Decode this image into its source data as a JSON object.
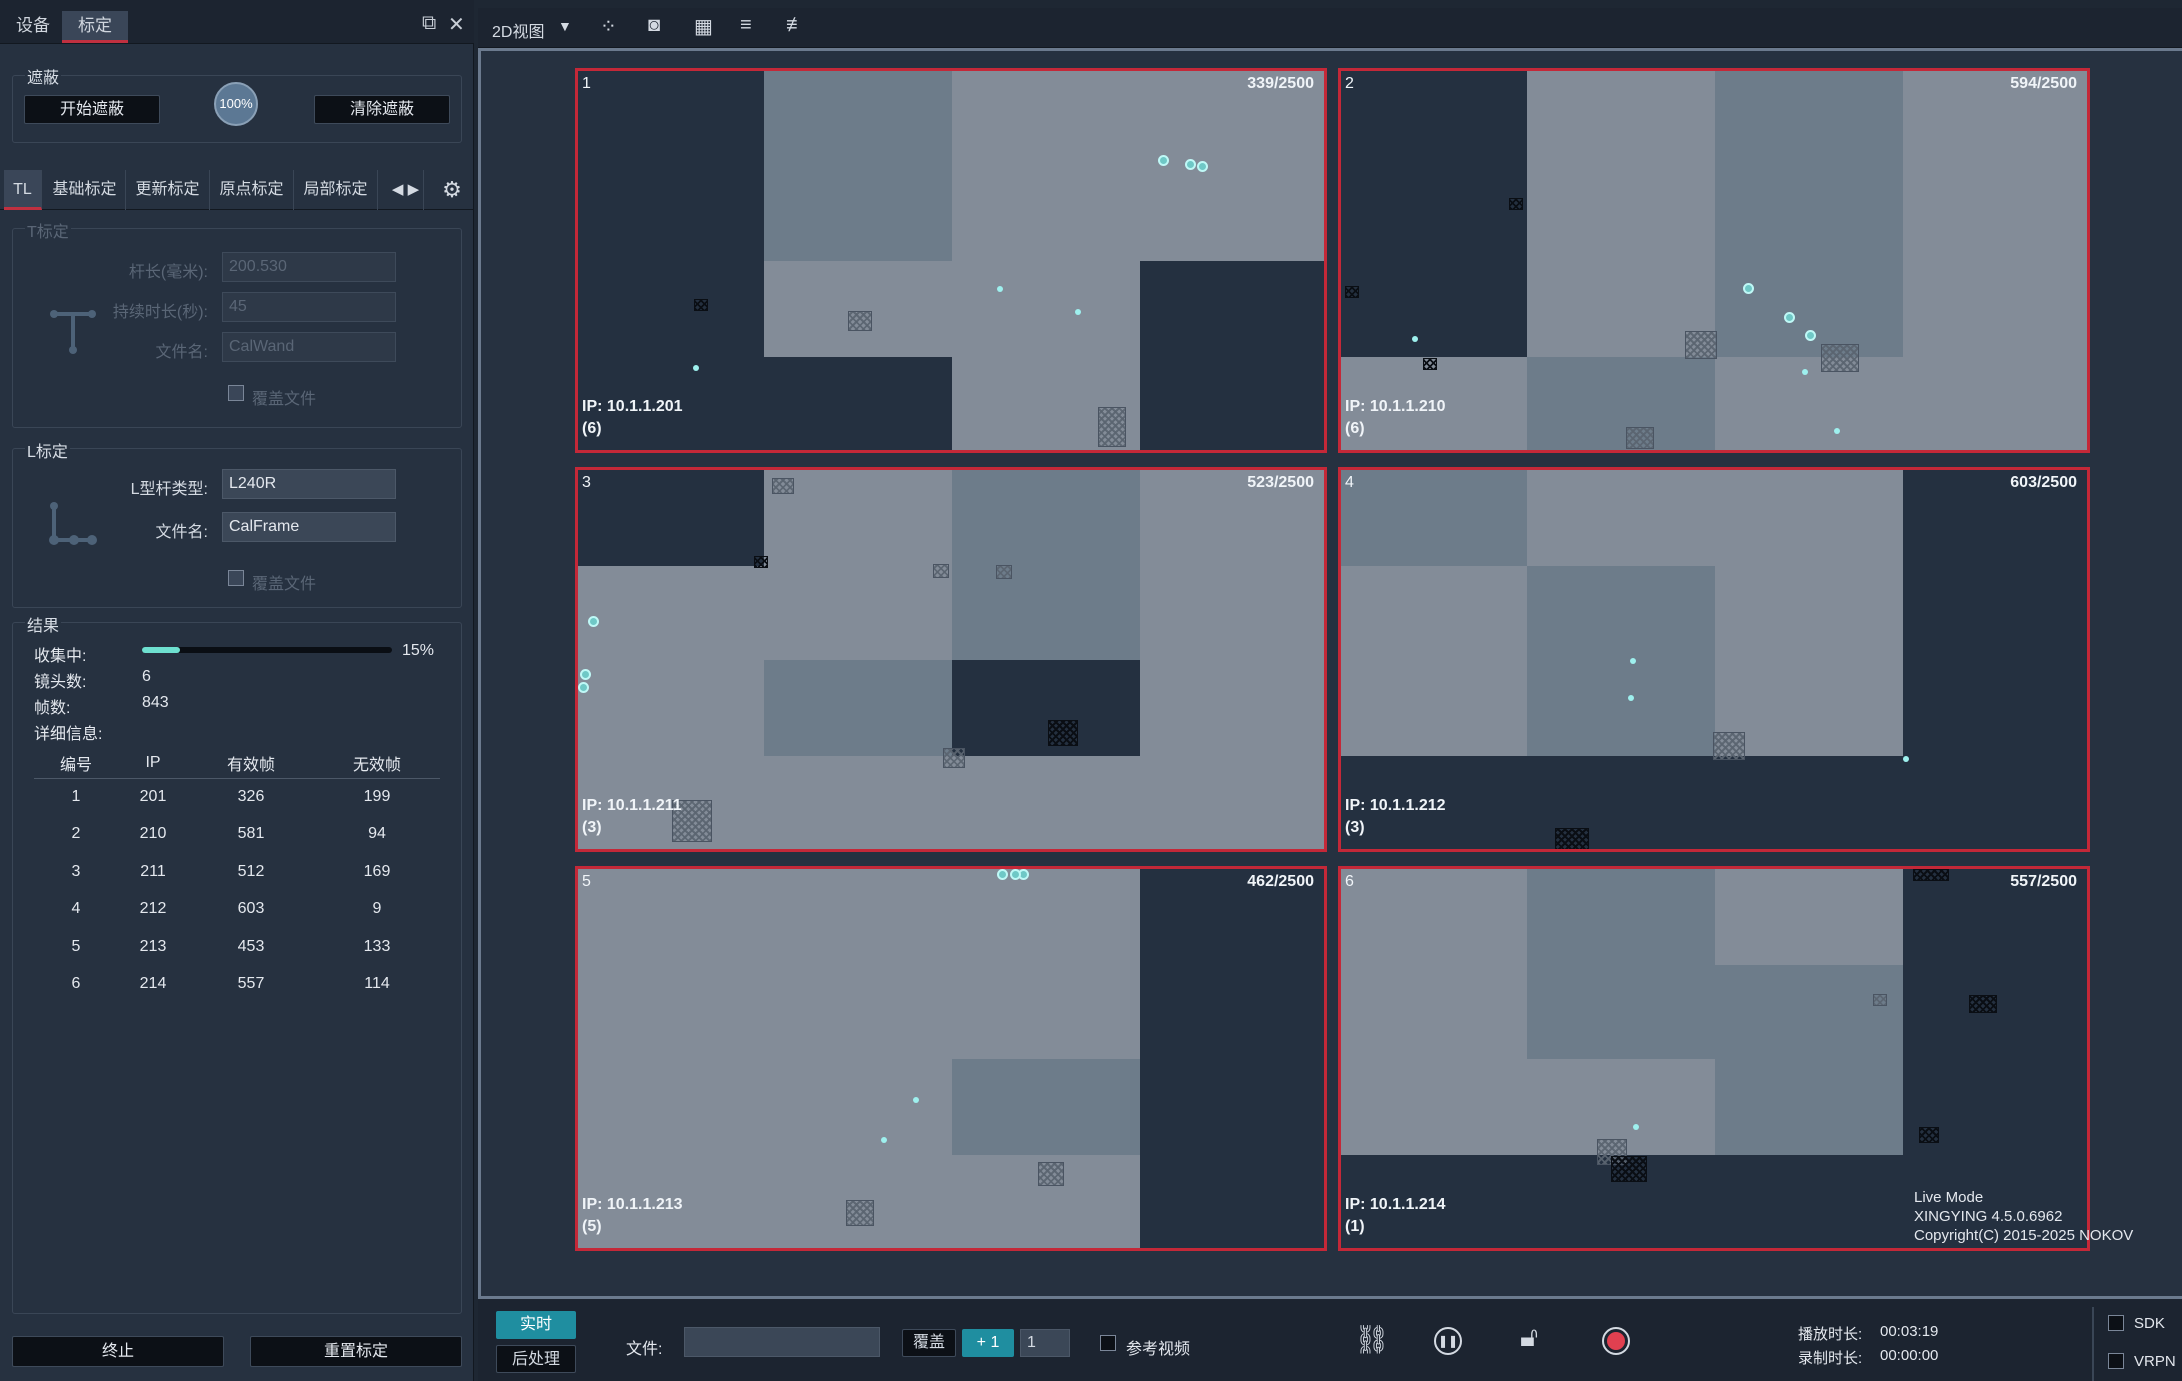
{
  "top_tabs": [
    "设备",
    "标定"
  ],
  "mask": {
    "title": "遮蔽",
    "start": "开始遮蔽",
    "pct": "100%",
    "clear": "清除遮蔽"
  },
  "subtabs": [
    "TL",
    "基础标定",
    "更新标定",
    "原点标定",
    "局部标定"
  ],
  "t_cal": {
    "title": "T标定",
    "len_label": "杆长(毫米):",
    "len_value": "200.530",
    "dur_label": "持续时长(秒):",
    "dur_value": "45",
    "file_label": "文件名:",
    "file_value": "CalWand",
    "overwrite": "覆盖文件"
  },
  "l_cal": {
    "title": "L标定",
    "type_label": "L型杆类型:",
    "type_value": "L240R",
    "file_label": "文件名:",
    "file_value": "CalFrame",
    "overwrite": "覆盖文件"
  },
  "result": {
    "title": "结果",
    "collecting_label": "收集中:",
    "collecting_pct": "15%",
    "progress_fraction": 0.15,
    "lens_label": "镜头数:",
    "lens_value": "6",
    "frames_label": "帧数:",
    "frames_value": "843",
    "detail_label": "详细信息:",
    "headers": [
      "编号",
      "IP",
      "有效帧",
      "无效帧"
    ],
    "rows": [
      [
        "1",
        "201",
        "326",
        "199"
      ],
      [
        "2",
        "210",
        "581",
        "94"
      ],
      [
        "3",
        "211",
        "512",
        "169"
      ],
      [
        "4",
        "212",
        "603",
        "9"
      ],
      [
        "5",
        "213",
        "453",
        "133"
      ],
      [
        "6",
        "214",
        "557",
        "114"
      ]
    ]
  },
  "left_buttons": {
    "stop": "终止",
    "reset": "重置标定"
  },
  "toolbar": {
    "view_label": "2D视图"
  },
  "cameras": [
    {
      "num": "1",
      "frames": "339/2500",
      "ip": "IP: 10.1.1.201",
      "count": "(6)"
    },
    {
      "num": "2",
      "frames": "594/2500",
      "ip": "IP: 10.1.1.210",
      "count": "(6)"
    },
    {
      "num": "3",
      "frames": "523/2500",
      "ip": "IP: 10.1.1.211",
      "count": "(3)"
    },
    {
      "num": "4",
      "frames": "603/2500",
      "ip": "IP: 10.1.1.212",
      "count": "(3)"
    },
    {
      "num": "5",
      "frames": "462/2500",
      "ip": "IP: 10.1.1.213",
      "count": "(5)"
    },
    {
      "num": "6",
      "frames": "557/2500",
      "ip": "IP: 10.1.1.214",
      "count": "(1)"
    }
  ],
  "info": {
    "mode": "Live Mode",
    "version": "XINGYING 4.5.0.6962",
    "copyright": "Copyright(C) 2015-2025 NOKOV"
  },
  "bottom": {
    "realtime": "实时",
    "post": "后处理",
    "file_label": "文件:",
    "overwrite": "覆盖",
    "plus": "+ 1",
    "step": "1",
    "ref_video": "参考视频",
    "play_label": "播放时长:",
    "play_value": "00:03:19",
    "rec_label": "录制时长:",
    "rec_value": "00:00:00",
    "sdk": "SDK",
    "vrpn": "VRPN"
  },
  "colors": {
    "accent_red": "#c42838",
    "accent_teal": "#1f8ea0",
    "progress": "#6ee0d0"
  }
}
